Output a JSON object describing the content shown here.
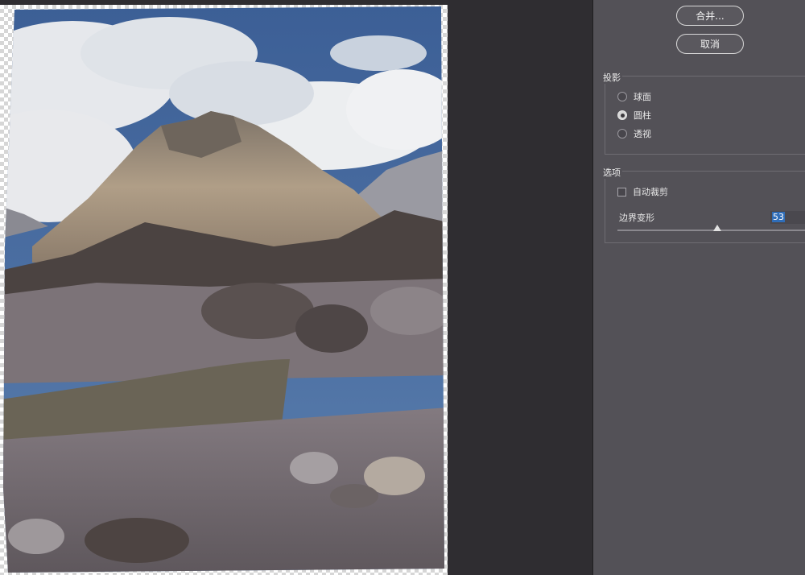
{
  "panel": {
    "merge_label": "合并...",
    "cancel_label": "取消",
    "projection": {
      "title": "投影",
      "options": [
        {
          "label": "球面",
          "checked": false
        },
        {
          "label": "圆柱",
          "checked": true
        },
        {
          "label": "透视",
          "checked": false
        }
      ]
    },
    "options": {
      "title": "选项",
      "auto_crop_label": "自动裁剪",
      "auto_crop_checked": false,
      "boundary_warp_label": "边界变形",
      "boundary_warp_value": "53",
      "boundary_warp_fraction": 0.53
    }
  },
  "colors": {
    "panel_bg": "#535157",
    "workspace_bg": "#2f2d31",
    "selection_highlight": "#2f6db8"
  }
}
